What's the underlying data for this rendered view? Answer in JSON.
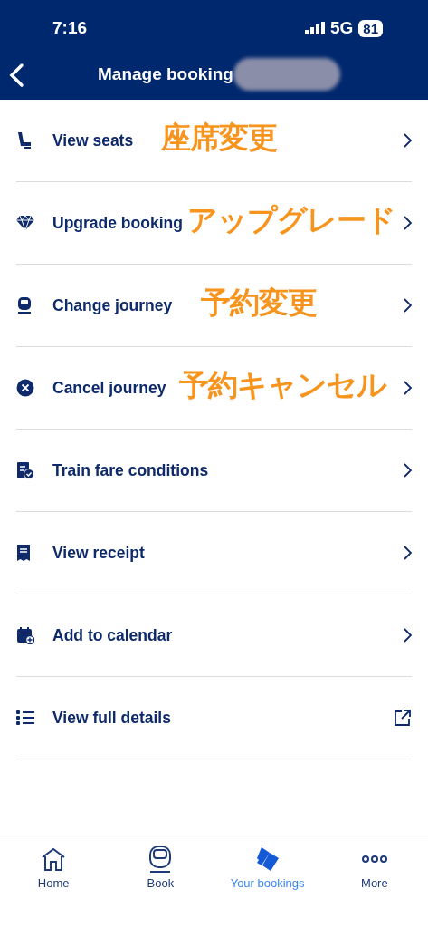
{
  "status_bar": {
    "time": "7:16",
    "network": "5G",
    "battery": "81"
  },
  "header": {
    "title": "Manage booking"
  },
  "menu": [
    {
      "label": "View seats",
      "kind": "link",
      "annotation": "座席変更"
    },
    {
      "label": "Upgrade booking",
      "kind": "link",
      "annotation": "アップグレード"
    },
    {
      "label": "Change journey",
      "kind": "link",
      "annotation": "予約変更"
    },
    {
      "label": "Cancel journey",
      "kind": "link",
      "annotation": "予約キャンセル"
    },
    {
      "label": "Train fare conditions",
      "kind": "link"
    },
    {
      "label": "View receipt",
      "kind": "link"
    },
    {
      "label": "Add to calendar",
      "kind": "link"
    },
    {
      "label": "View full details",
      "kind": "external"
    }
  ],
  "tab_bar": [
    {
      "label": "Home",
      "selected": false
    },
    {
      "label": "Book",
      "selected": false
    },
    {
      "label": "Your bookings",
      "selected": true
    },
    {
      "label": "More",
      "selected": false
    }
  ]
}
